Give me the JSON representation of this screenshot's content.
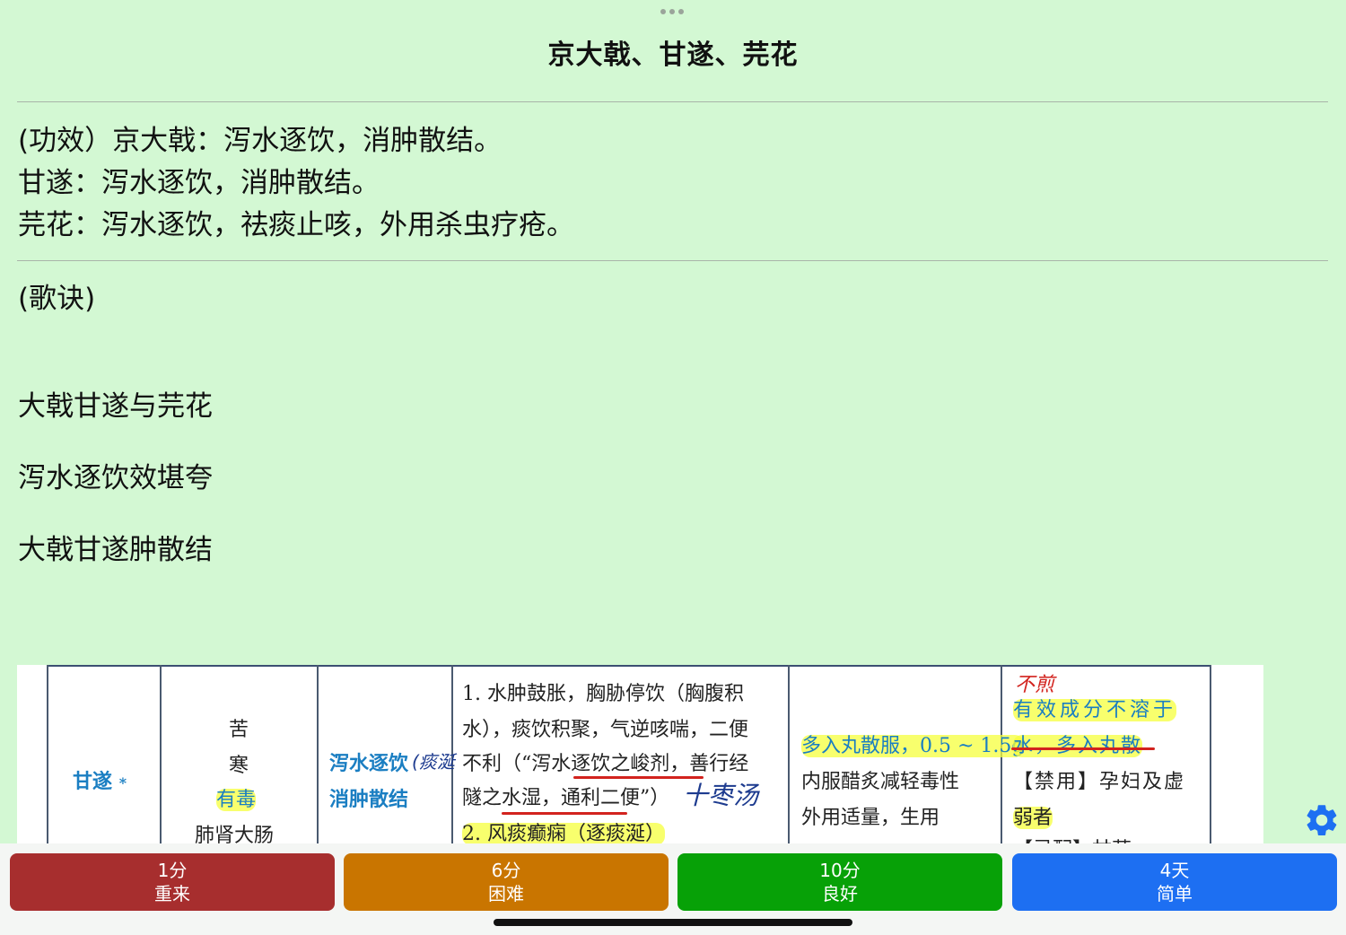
{
  "header": {
    "title": "京大戟、甘遂、芫花"
  },
  "efficacy": {
    "lines": [
      "(功效）京大戟：泻水逐饮，消肿散结。",
      "甘遂：泻水逐饮，消肿散结。",
      "芫花：泻水逐饮，祛痰止咳，外用杀虫疗疮。"
    ]
  },
  "mnemonic": {
    "heading": "(歌诀)",
    "lines": [
      "大戟甘遂与芫花",
      "泻水逐饮效堪夸",
      "大戟甘遂肿散结"
    ]
  },
  "scan": {
    "herb": "甘遂",
    "herb_mark": "*",
    "nature": [
      "苦",
      "寒",
      "有毒",
      "肺肾大肠"
    ],
    "effect": [
      "泻水逐饮",
      "消肿散结"
    ],
    "effect_note": "(痰涎",
    "indications": [
      "1. 水肿鼓胀，胸胁停饮（胸腹积",
      "水），痰饮积聚，气逆咳喘，二便",
      "不利（“泻水逐饮之峻剂，善行经",
      "隧之水湿，通利二便”）",
      "2. 风痰癫痫（逐痰涎）"
    ],
    "indication_note": "十枣汤",
    "usage": [
      "多入丸散服，0.5 ~ 1.5g",
      "内服醋炙减轻毒性",
      "外用适量，生用"
    ],
    "cautions": [
      "有效成分不溶于",
      "水，多入丸散",
      "【禁用】孕妇及虚",
      "弱者",
      "【忌配】甘草"
    ],
    "caution_note": "不煎"
  },
  "settings": {
    "icon": "gear-icon",
    "color": "#1d6ff2"
  },
  "buttons": [
    {
      "time": "1分",
      "label": "重来",
      "color": "#a72e2e"
    },
    {
      "time": "6分",
      "label": "困难",
      "color": "#c97500"
    },
    {
      "time": "10分",
      "label": "良好",
      "color": "#07a107"
    },
    {
      "time": "4天",
      "label": "简单",
      "color": "#1d6ff2"
    }
  ]
}
